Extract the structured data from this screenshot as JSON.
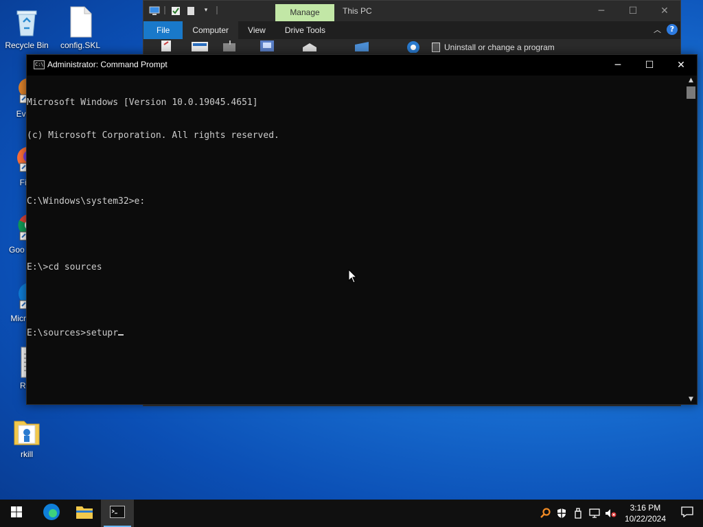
{
  "desktop": {
    "icons": [
      {
        "label": "Recycle Bin"
      },
      {
        "label": "config.SKL"
      },
      {
        "label": "Every"
      },
      {
        "label": "Fire"
      },
      {
        "label": "Goo Chro"
      },
      {
        "label": "Micro Ed"
      },
      {
        "label": "Rkil"
      },
      {
        "label": "rkill"
      }
    ]
  },
  "explorer": {
    "manage_tab": "Manage",
    "caption": "This PC",
    "ribbon_tabs": [
      "File",
      "Computer",
      "View",
      "Drive Tools"
    ],
    "uninstall_label": "Uninstall or change a program"
  },
  "cmd": {
    "title": "Administrator: Command Prompt",
    "lines": [
      "Microsoft Windows [Version 10.0.19045.4651]",
      "(c) Microsoft Corporation. All rights reserved.",
      "",
      "C:\\Windows\\system32>e:",
      "",
      "E:\\>cd sources",
      "",
      "E:\\sources>setupr"
    ]
  },
  "taskbar": {
    "time": "3:16 PM",
    "date": "10/22/2024"
  },
  "colors": {
    "manage_tab": "#c2e7a6",
    "file_tab": "#1979ca",
    "console_bg": "#0c0c0c",
    "console_text": "#cccccc",
    "taskbar": "#101010"
  },
  "icons": [
    "recycle-bin-icon",
    "file-icon",
    "search-app-icon",
    "firefox-icon",
    "chrome-icon",
    "edge-icon",
    "document-icon",
    "folder-icon",
    "windows-start-icon",
    "file-explorer-icon",
    "cmd-icon",
    "search-tray-icon",
    "shield-icon",
    "usb-icon",
    "network-icon",
    "volume-muted-icon",
    "notification-icon"
  ]
}
